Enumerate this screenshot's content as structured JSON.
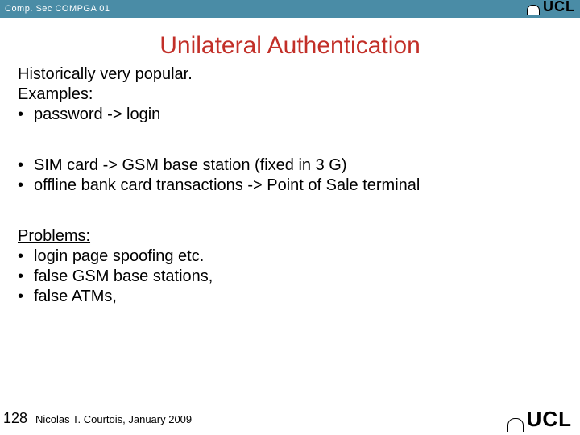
{
  "header": {
    "course": "Comp. Sec COMPGA 01",
    "logo_name": "ucl-logo"
  },
  "title": "Unilateral Authentication",
  "intro": {
    "line1": "Historically very popular.",
    "line2": "Examples:",
    "bullet1": "password -> login"
  },
  "examples2": {
    "bullet1": "SIM card -> GSM base station (fixed in 3 G)",
    "bullet2": "offline bank card transactions -> Point of Sale terminal"
  },
  "problems": {
    "heading": "Problems:",
    "bullet1": "login page spoofing etc.",
    "bullet2": "false GSM base stations,",
    "bullet3": "false ATMs,"
  },
  "footer": {
    "page": "128",
    "author": "Nicolas T. Courtois, January 2009",
    "logo_name": "ucl-logo"
  }
}
